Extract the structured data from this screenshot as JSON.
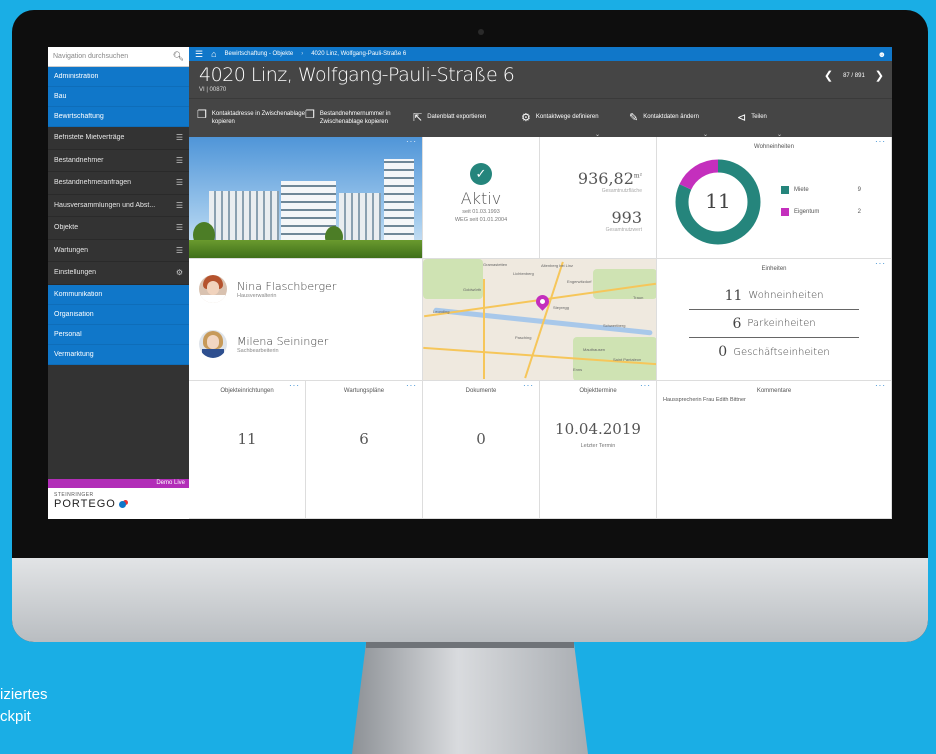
{
  "sidebar": {
    "search_placeholder": "Navigation durchsuchen",
    "top_items": [
      {
        "label": "Administration"
      },
      {
        "label": "Bau"
      },
      {
        "label": "Bewirtschaftung"
      }
    ],
    "dark_items": [
      {
        "label": "Befristete Mietverträge",
        "icon": "list-icon"
      },
      {
        "label": "Bestandnehmer",
        "icon": "list-icon"
      },
      {
        "label": "Bestandnehmeranfragen",
        "icon": "list-icon"
      },
      {
        "label": "Hausversammlungen und Abst...",
        "icon": "list-icon"
      },
      {
        "label": "Objekte",
        "icon": "list-icon"
      },
      {
        "label": "Wartungen",
        "icon": "list-icon"
      },
      {
        "label": "Einstellungen",
        "icon": "gear-icon"
      }
    ],
    "bottom_items": [
      {
        "label": "Kommunikation"
      },
      {
        "label": "Organisation"
      },
      {
        "label": "Personal"
      },
      {
        "label": "Vermarktung"
      }
    ],
    "demo_label": "Demo Live",
    "logo_top": "STEINRINGER",
    "logo_main": "PORTEGO"
  },
  "topbar": {
    "crumb1": "Bewirtschaftung - Objekte",
    "crumb2": "4020 Linz, Wolfgang-Pauli-Straße 6"
  },
  "header": {
    "title": "4020 Linz, Wolfgang-Pauli-Straße 6",
    "sub": "VI  |  00870",
    "pager": "87 / 891"
  },
  "toolbar": [
    {
      "label": "Kontaktadresse in Zwischenablage kopieren",
      "icon": "copy-icon",
      "dropdown": false
    },
    {
      "label": "Bestandnehmernummer in Zwischenablage kopieren",
      "icon": "copy-icon",
      "dropdown": false
    },
    {
      "label": "Datenblatt exportieren",
      "icon": "export-icon",
      "dropdown": false
    },
    {
      "label": "Kontaktwege definieren",
      "icon": "gears-icon",
      "dropdown": true
    },
    {
      "label": "Kontaktdaten ändern",
      "icon": "pencil-icon",
      "dropdown": true
    },
    {
      "label": "Teilen",
      "icon": "share-icon",
      "dropdown": true
    }
  ],
  "status": {
    "label": "Aktiv",
    "since1": "seit 01.03.1993",
    "since2": "WEG seit 01.01.2004"
  },
  "area": {
    "value": "936,82",
    "unit": "m²",
    "sub1": "Gesamtnutzfläche",
    "value2": "993",
    "sub2": "Gesamtnutzwert"
  },
  "wohneinheiten": {
    "title": "Wohneinheiten",
    "total": "11",
    "legend": [
      {
        "label": "Miete",
        "value": "9",
        "color": "#25857c"
      },
      {
        "label": "Eigentum",
        "value": "2",
        "color": "#c42fbd"
      }
    ],
    "fractions": [
      0.818,
      0.182
    ]
  },
  "persons": [
    {
      "name": "Nina Flaschberger",
      "role": "Hausverwalterin"
    },
    {
      "name": "Milena Seininger",
      "role": "Sachbearbeiterin"
    }
  ],
  "einheiten": {
    "title": "Einheiten",
    "rows": [
      {
        "n": "11",
        "t": "Wohneinheiten"
      },
      {
        "n": "6",
        "t": "Parkeinheiten"
      },
      {
        "n": "0",
        "t": "Geschäftseinheiten"
      }
    ]
  },
  "bottom_cards": [
    {
      "title": "Objekteinrichtungen",
      "value": "11"
    },
    {
      "title": "Wartungspläne",
      "value": "6"
    },
    {
      "title": "Dokumente",
      "value": "0"
    },
    {
      "title": "Objekttermine",
      "value": "10.04.2019",
      "sub": "Letzter Termin"
    }
  ],
  "kommentare": {
    "title": "Kommentare",
    "text": "Haussprecherin Frau Edith Bittner"
  },
  "map_labels": [
    "Gramastetten",
    "Lichtenberg",
    "Altenberg bei Linz",
    "Engerwitzdorf",
    "Goldwörth",
    "Steyregg",
    "Leonding",
    "Pasching",
    "Schwertberg",
    "Mauthausen",
    "Saint Pantaleon",
    "Enns",
    "Traun"
  ],
  "caption": [
    "iziertes",
    "ckpit"
  ],
  "colors": {
    "accent": "#1077c9",
    "teal": "#25857c",
    "magenta": "#c42fbd"
  }
}
